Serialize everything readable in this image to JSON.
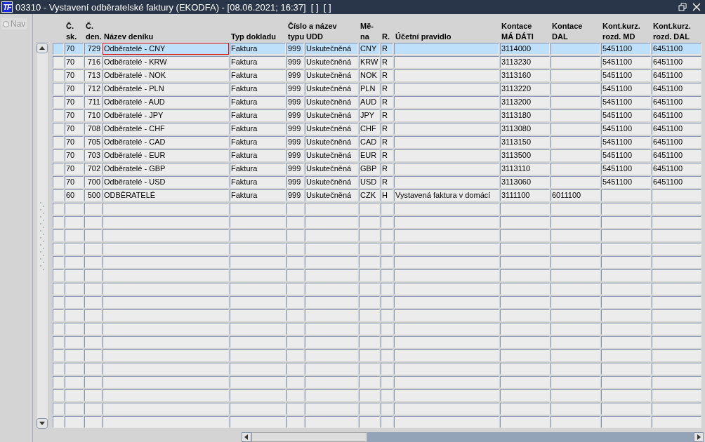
{
  "window": {
    "logo": "TF",
    "title": "03310 - Vystavení odběratelské faktury (EKODFA) - [08.06.2021; 16:37]  [ ]  [ ]"
  },
  "nav": {
    "label": "Nav",
    "selected": false
  },
  "table": {
    "columns": [
      {
        "lines": [
          "Č.",
          "sk."
        ]
      },
      {
        "lines": [
          "Č.",
          "den."
        ]
      },
      {
        "lines": [
          "Název deníku"
        ]
      },
      {
        "lines": [
          "Typ dokladu"
        ]
      },
      {
        "group": "Číslo a název",
        "lines": [
          "typu"
        ]
      },
      {
        "lines": [
          "UDD"
        ]
      },
      {
        "lines": [
          "Mě-",
          "na"
        ]
      },
      {
        "lines": [
          "R."
        ]
      },
      {
        "lines": [
          "Účetní pravidlo"
        ]
      },
      {
        "lines": [
          "Kontace",
          "MÁ DÁTI"
        ]
      },
      {
        "lines": [
          "Kontace",
          "DAL"
        ]
      },
      {
        "lines": [
          "Kont.kurz.",
          "rozd. MD"
        ]
      },
      {
        "lines": [
          "Kont.kurz.",
          "rozd. DAL"
        ]
      }
    ],
    "rows": [
      {
        "selected": true,
        "focused": true,
        "cells": [
          "70",
          "729",
          "Odběratelé - CNY",
          "Faktura",
          "999",
          "Uskutečněná",
          "CNY",
          "R",
          "",
          "3114000",
          "",
          "5451100",
          "6451100"
        ]
      },
      {
        "selected": false,
        "focused": false,
        "cells": [
          "70",
          "716",
          "Odběratelé - KRW",
          "Faktura",
          "999",
          "Uskutečněná",
          "KRW",
          "R",
          "",
          "3113230",
          "",
          "5451100",
          "6451100"
        ]
      },
      {
        "selected": false,
        "focused": false,
        "cells": [
          "70",
          "713",
          "Odběratelé - NOK",
          "Faktura",
          "999",
          "Uskutečněná",
          "NOK",
          "R",
          "",
          "3113160",
          "",
          "5451100",
          "6451100"
        ]
      },
      {
        "selected": false,
        "focused": false,
        "cells": [
          "70",
          "712",
          "Odběratelé - PLN",
          "Faktura",
          "999",
          "Uskutečněná",
          "PLN",
          "R",
          "",
          "3113220",
          "",
          "5451100",
          "6451100"
        ]
      },
      {
        "selected": false,
        "focused": false,
        "cells": [
          "70",
          "711",
          "Odběratelé - AUD",
          "Faktura",
          "999",
          "Uskutečněná",
          "AUD",
          "R",
          "",
          "3113200",
          "",
          "5451100",
          "6451100"
        ]
      },
      {
        "selected": false,
        "focused": false,
        "cells": [
          "70",
          "710",
          "Odběratelé - JPY",
          "Faktura",
          "999",
          "Uskutečněná",
          "JPY",
          "R",
          "",
          "3113180",
          "",
          "5451100",
          "6451100"
        ]
      },
      {
        "selected": false,
        "focused": false,
        "cells": [
          "70",
          "708",
          "Odběratelé - CHF",
          "Faktura",
          "999",
          "Uskutečněná",
          "CHF",
          "R",
          "",
          "3113080",
          "",
          "5451100",
          "6451100"
        ]
      },
      {
        "selected": false,
        "focused": false,
        "cells": [
          "70",
          "705",
          "Odběratelé - CAD",
          "Faktura",
          "999",
          "Uskutečněná",
          "CAD",
          "R",
          "",
          "3113150",
          "",
          "5451100",
          "6451100"
        ]
      },
      {
        "selected": false,
        "focused": false,
        "cells": [
          "70",
          "703",
          "Odběratelé - EUR",
          "Faktura",
          "999",
          "Uskutečněná",
          "EUR",
          "R",
          "",
          "3113500",
          "",
          "5451100",
          "6451100"
        ]
      },
      {
        "selected": false,
        "focused": false,
        "cells": [
          "70",
          "702",
          "Odběratelé - GBP",
          "Faktura",
          "999",
          "Uskutečněná",
          "GBP",
          "R",
          "",
          "3113110",
          "",
          "5451100",
          "6451100"
        ]
      },
      {
        "selected": false,
        "focused": false,
        "cells": [
          "70",
          "700",
          "Odběratelé - USD",
          "Faktura",
          "999",
          "Uskutečněná",
          "USD",
          "R",
          "",
          "3113060",
          "",
          "5451100",
          "6451100"
        ]
      },
      {
        "selected": false,
        "focused": false,
        "cells": [
          "60",
          "500",
          "ODBĚRATELÉ",
          "Faktura",
          "999",
          "Uskutečněná",
          "CZK",
          "H",
          "Vystavená faktura v domácí",
          "3111100",
          "6011100",
          "",
          ""
        ]
      }
    ]
  }
}
